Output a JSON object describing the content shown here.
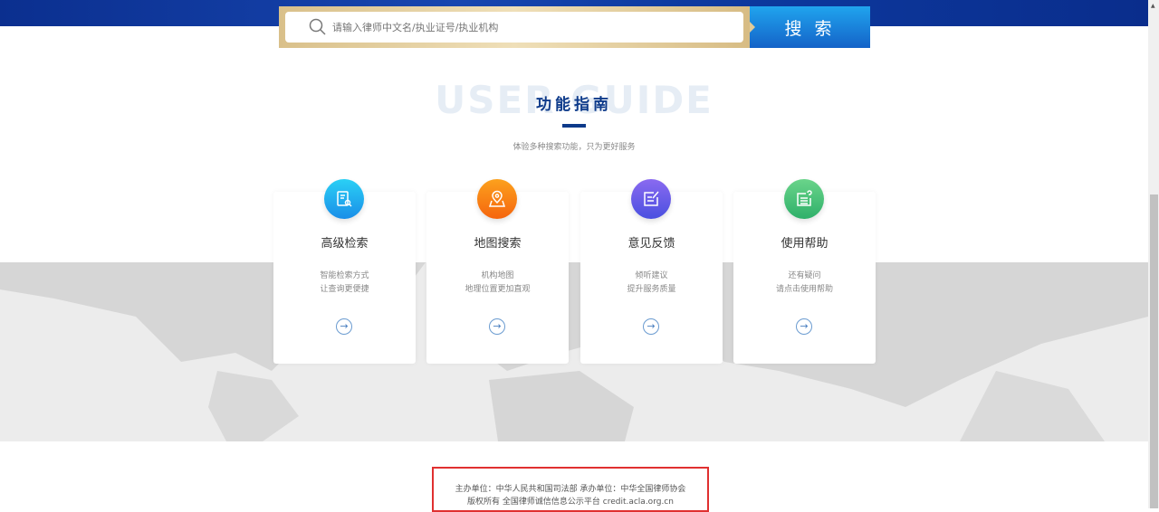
{
  "search": {
    "placeholder": "请输入律师中文名/执业证号/执业机构",
    "button": "搜 索"
  },
  "guide": {
    "bg_text": "USER GUIDE",
    "title": "功能指南",
    "subtitle": "体验多种搜索功能，只为更好服务"
  },
  "cards": [
    {
      "title": "高级检索",
      "line1": "智能检索方式",
      "line2": "让查询更便捷",
      "icon": "document-search-icon",
      "color": "#1fa8f0"
    },
    {
      "title": "地图搜索",
      "line1": "机构地图",
      "line2": "地理位置更加直观",
      "icon": "map-pin-icon",
      "color": "#f7871a"
    },
    {
      "title": "意见反馈",
      "line1": "倾听建议",
      "line2": "提升服务质量",
      "icon": "edit-note-icon",
      "color": "#6a5ae8"
    },
    {
      "title": "使用帮助",
      "line1": "还有疑问",
      "line2": "请点击使用帮助",
      "icon": "help-document-icon",
      "color": "#3dbf77"
    }
  ],
  "footer": {
    "line1": "主办单位：中华人民共和国司法部 承办单位：中华全国律师协会",
    "line2": "版权所有 全国律师诚信信息公示平台 credit.acla.org.cn"
  }
}
